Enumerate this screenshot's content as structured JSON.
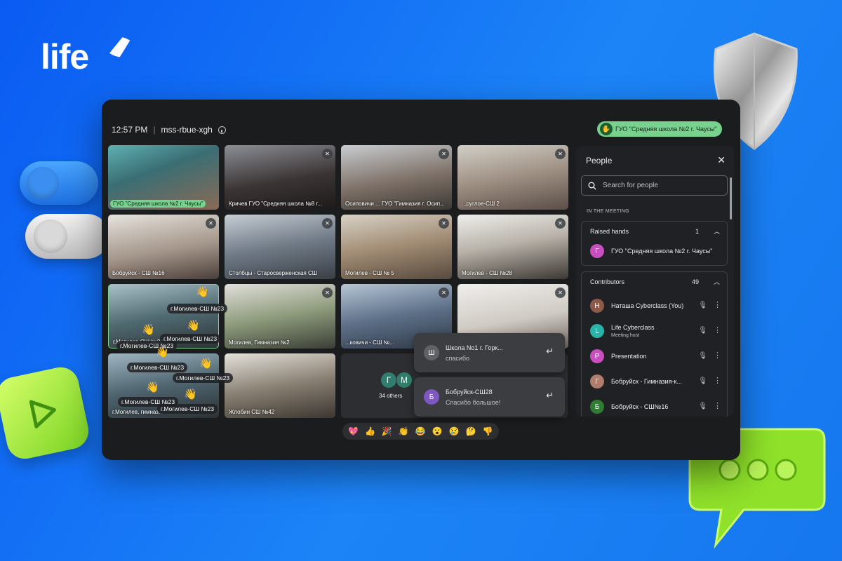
{
  "brand": {
    "logo_text": "life"
  },
  "meeting": {
    "time": "12:57 PM",
    "separator": "|",
    "code": "mss-rbue-xgh"
  },
  "hand_chip": {
    "label": "ГУО \"Средняя школа №2 г. Чаусы\""
  },
  "tiles": [
    {
      "label": "ГУО \"Средняя школа №2 г. Чаусы\""
    },
    {
      "label": "Кричев ГУО \"Средняя школа №8 г..."
    },
    {
      "label": "Осиповичи ... ГУО \"Гимназия г. Осип..."
    },
    {
      "label": "...руглое-СШ 2"
    },
    {
      "label": "Бобруйск - СШ №16"
    },
    {
      "label": "Столбцы - Старосверженская СШ"
    },
    {
      "label": "Могилев - СШ № 5"
    },
    {
      "label": "Могилев - СШ №28"
    },
    {
      "label": "г.Могилев-СШ №23"
    },
    {
      "label": "Могилев, Гимназия №2"
    },
    {
      "label": "...ковичи - СШ №..."
    },
    {
      "label": ""
    },
    {
      "label": "г.Могилев, гимназ..."
    },
    {
      "label": "Жлобин СШ №42"
    }
  ],
  "hand_tags": [
    "г.Могилев-СШ №23",
    "г.Могилев-СШ №23",
    "г.Могилев-СШ №23",
    "г.Могилев-СШ №23",
    "г.Могилев-СШ №23",
    "г.Могилев-СШ №23",
    "г.Могилев-СШ №23"
  ],
  "others": {
    "avatars": [
      "Г",
      "М"
    ],
    "count_label": "34 others"
  },
  "toasts": [
    {
      "initial": "Ш",
      "name": "Школа No1 г. Горк...",
      "message": "спасибо"
    },
    {
      "initial": "Б",
      "name": "Бобруйск-СШ28",
      "message": "Спасибо большое!"
    }
  ],
  "reactions": [
    "💖",
    "👍",
    "🎉",
    "👏",
    "😂",
    "😮",
    "😢",
    "🤔",
    "👎"
  ],
  "people_panel": {
    "title": "People",
    "search_placeholder": "Search for people",
    "section_label": "IN THE MEETING",
    "raised_hands": {
      "title": "Raised hands",
      "count": "1",
      "items": [
        {
          "initial": "Г",
          "name": "ГУО \"Средняя школа №2 г. Чаусы\"",
          "color": "#c94fc0"
        }
      ]
    },
    "contributors": {
      "title": "Contributors",
      "count": "49",
      "items": [
        {
          "initial": "Н",
          "name": "Наташа Cyberclass (You)",
          "sub": "",
          "color": "#8d5a4a"
        },
        {
          "initial": "L",
          "name": "Life Cyberclass",
          "sub": "Meeting host",
          "color": "#2ab3a8"
        },
        {
          "initial": "P",
          "name": "Presentation",
          "sub": "",
          "color": "#c94fc0"
        },
        {
          "initial": "Г",
          "name": "Бобруйск - Гимназия-к...",
          "sub": "",
          "color": "#b07c6c"
        },
        {
          "initial": "Б",
          "name": "Бобруйск - СШ№16",
          "sub": "",
          "color": "#2e7d32"
        }
      ]
    }
  },
  "colors": {
    "background": "#1677ee",
    "accent_green": "#79d18e",
    "window": "#1b1c1e"
  }
}
